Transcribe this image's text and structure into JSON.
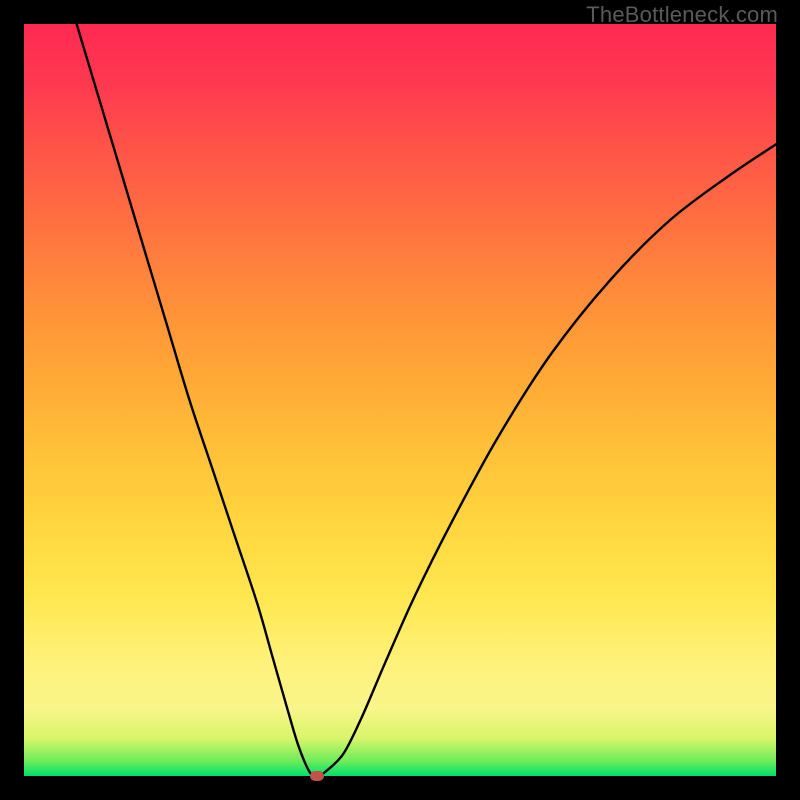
{
  "watermark": "TheBottleneck.com",
  "chart_data": {
    "type": "line",
    "title": "",
    "xlabel": "",
    "ylabel": "",
    "xlim": [
      0,
      100
    ],
    "ylim": [
      0,
      100
    ],
    "grid": false,
    "legend": false,
    "series": [
      {
        "name": "curve",
        "x": [
          7,
          10,
          13,
          16,
          19,
          22,
          25,
          28,
          31,
          33,
          35,
          36.5,
          38,
          39,
          40,
          42.5,
          45,
          48,
          52,
          57,
          63,
          70,
          78,
          86,
          94,
          100
        ],
        "y": [
          100,
          90,
          80,
          70,
          60,
          50,
          41,
          32,
          23,
          16,
          9,
          4,
          0.5,
          0,
          0.5,
          3,
          8,
          15,
          24,
          34,
          45,
          56,
          66,
          74,
          80,
          84
        ]
      }
    ],
    "annotations": [
      {
        "name": "min-marker",
        "x": 39,
        "y": 0
      }
    ],
    "colors": {
      "curve": "#000000",
      "marker": "#c0524c",
      "gradient_top": "#ff2a52",
      "gradient_bottom": "#00e06a"
    }
  }
}
